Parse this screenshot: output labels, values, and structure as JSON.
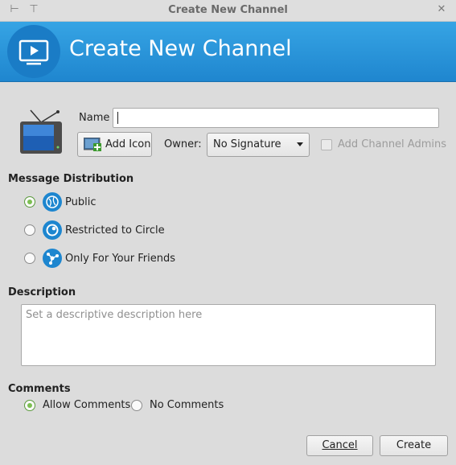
{
  "window": {
    "title": "Create New Channel"
  },
  "header": {
    "title": "Create New Channel"
  },
  "form": {
    "name_label": "Name",
    "name_value": "",
    "add_icon_label": "Add Icon",
    "owner_label": "Owner:",
    "owner_value": "No Signature",
    "add_admins_label": "Add Channel Admins"
  },
  "distribution": {
    "heading": "Message Distribution",
    "options": [
      {
        "label": "Public",
        "selected": true
      },
      {
        "label": "Restricted to Circle",
        "selected": false
      },
      {
        "label": "Only For Your Friends",
        "selected": false
      }
    ]
  },
  "description": {
    "heading": "Description",
    "placeholder": "Set a descriptive description here"
  },
  "comments": {
    "heading": "Comments",
    "options": [
      {
        "label": "Allow Comments",
        "selected": true
      },
      {
        "label": "No Comments",
        "selected": false
      }
    ]
  },
  "buttons": {
    "cancel": "Cancel",
    "create": "Create"
  },
  "colors": {
    "header": "#2a96dc",
    "accent": "#7cbf52"
  }
}
